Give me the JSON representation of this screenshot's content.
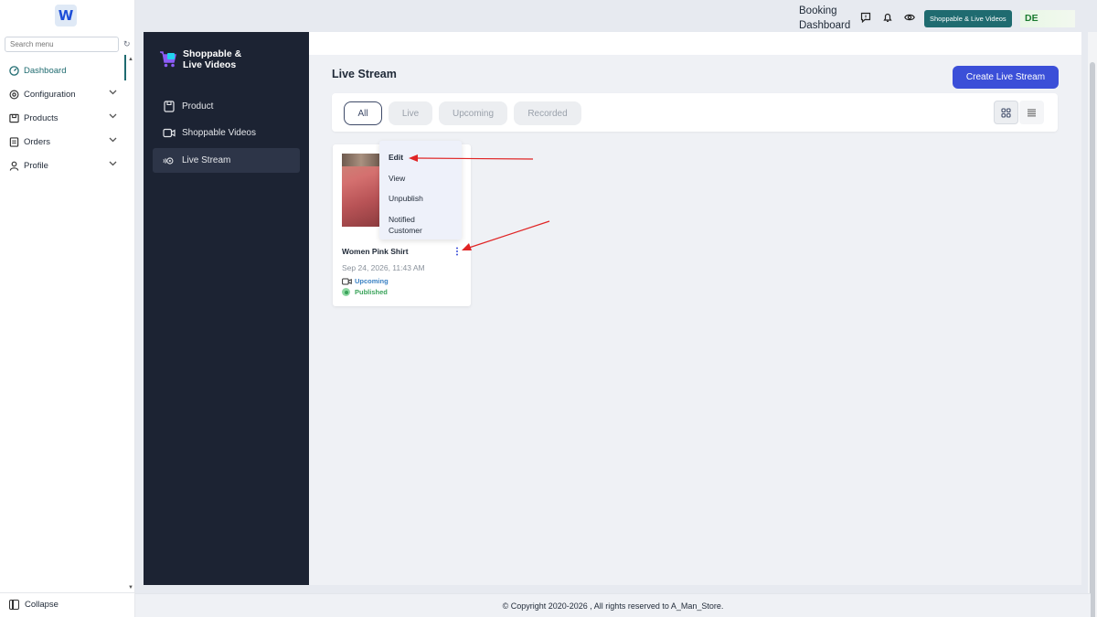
{
  "sidebar": {
    "search_placeholder": "Search menu",
    "items": [
      {
        "label": "Dashboard",
        "icon": "dashboard-icon"
      },
      {
        "label": "Configuration",
        "icon": "gear-icon"
      },
      {
        "label": "Products",
        "icon": "box-icon"
      },
      {
        "label": "Orders",
        "icon": "orders-icon"
      },
      {
        "label": "Profile",
        "icon": "user-icon"
      }
    ],
    "collapse_label": "Collapse"
  },
  "header": {
    "booking_line1": "Booking",
    "booking_line2": "Dashboard",
    "app_button": "Shoppable & Live Videos",
    "language": "DE"
  },
  "app_nav": {
    "title_line1": "Shoppable &",
    "title_line2": "Live Videos",
    "items": [
      {
        "label": "Product"
      },
      {
        "label": "Shoppable Videos"
      },
      {
        "label": "Live Stream"
      }
    ]
  },
  "main": {
    "page_title": "Live Stream",
    "create_button": "Create Live Stream",
    "filters": [
      "All",
      "Live",
      "Upcoming",
      "Recorded"
    ],
    "active_filter": "All"
  },
  "card": {
    "name": "Women Pink Shirt",
    "date": "Sep 24, 2026, 11:43 AM",
    "status": "Upcoming",
    "publish_state": "Published"
  },
  "context_menu": {
    "items": [
      "Edit",
      "View",
      "Unpublish",
      "Notified",
      "Customer"
    ]
  },
  "footer": {
    "text": "© Copyright 2020-2026 , All rights reserved to A_Man_Store."
  },
  "colors": {
    "accent": "#1f6b70",
    "primary_button": "#3b4fd8",
    "app_nav_bg": "#1c2333",
    "annotation_arrow": "#e02424"
  }
}
